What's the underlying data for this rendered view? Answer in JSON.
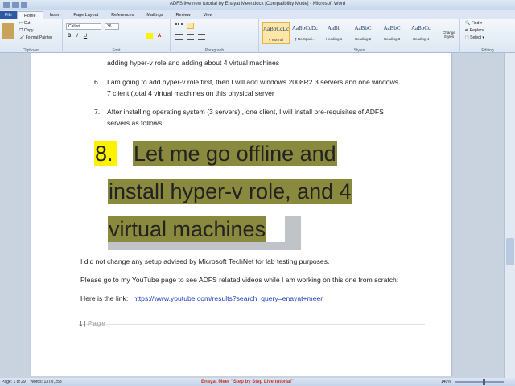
{
  "window": {
    "title": "ADFS live new  tutorial by Enayat Meer.docx [Compatibility Mode] - Microsoft Word"
  },
  "tabs": [
    "File",
    "Home",
    "Insert",
    "Page Layout",
    "References",
    "Mailings",
    "Review",
    "View"
  ],
  "ribbon": {
    "clipboard": {
      "label": "Clipboard",
      "cut": "Cut",
      "copy": "Copy",
      "format_painter": "Format Painter"
    },
    "font": {
      "label": "Font",
      "family": "Calibri",
      "size": "36",
      "bold": "B",
      "italic": "I",
      "underline": "U"
    },
    "paragraph": {
      "label": "Paragraph"
    },
    "styles": {
      "label": "Styles",
      "items": [
        {
          "sample": "AaBbCcDc",
          "name": "¶ Normal"
        },
        {
          "sample": "AaBbCcDc",
          "name": "¶ No Spaci..."
        },
        {
          "sample": "AaBb",
          "name": "Heading 1"
        },
        {
          "sample": "AaBbC",
          "name": "Heading 2"
        },
        {
          "sample": "AaBbC",
          "name": "Heading 3"
        },
        {
          "sample": "AaBbCc",
          "name": "Heading 4"
        }
      ],
      "change_styles": "Change Styles"
    },
    "editing": {
      "label": "Editing",
      "find": "Find",
      "replace": "Replace",
      "select": "Select"
    }
  },
  "document": {
    "line_top": "adding hyper-v role and adding about 4 virtual machines",
    "item6_num": "6.",
    "item6_line1": "I am going to add hyper-v role first, then I will add windows 2008R2 3 servers and one windows",
    "item6_line2": "7 client (total 4 virtual machines on this physical server",
    "item7_num": "7.",
    "item7_line1": "After installing operating system (3 servers) , one client, I will install pre-requisites of ADFS",
    "item7_line2": "servers  as follows",
    "item8_num": "8.",
    "item8_line1": "Let me go offline and",
    "item8_line2": "install hyper-v role, and 4",
    "item8_line3": "virtual machines",
    "para1": "I did not change any setup advised by Microsoft TechNet for lab testing purposes.",
    "para2": "Please go to my YouTube page to see ADFS related videos while I am working on this one from scratch:",
    "link_prefix": "Here is the link:",
    "link": "https://www.youtube.com/results?search_query=enayat+meer",
    "footer_num": "1 |",
    "footer_page": "Page"
  },
  "status": {
    "page": "Page: 1 of 29",
    "words": "Words: 137/7,253",
    "author": "Enayat Meer  \"Step by Step Live tutorial\"",
    "zoom": "140%"
  }
}
